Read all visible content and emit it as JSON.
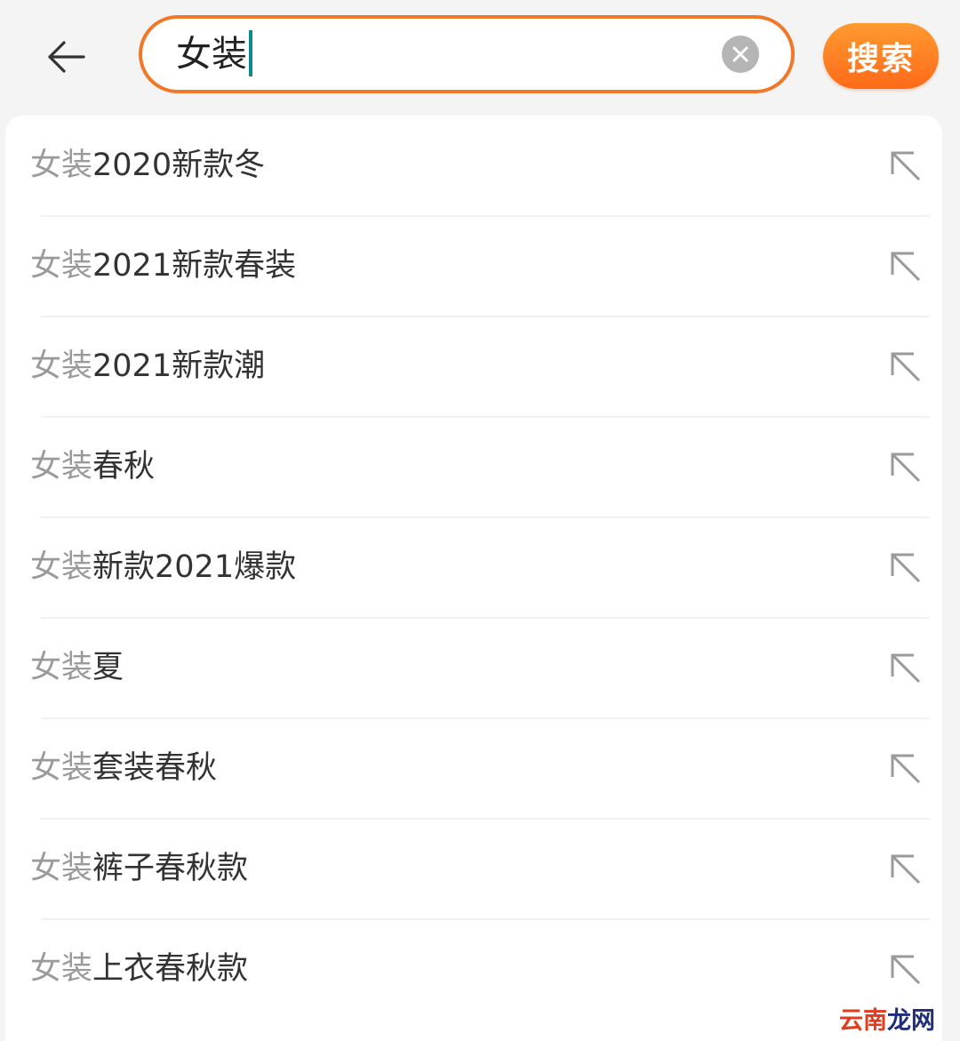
{
  "header": {
    "back_icon": "arrow-left-icon",
    "search": {
      "value": "女装",
      "clear_icon": "clear-circle-x-icon"
    },
    "search_button_label": "搜索"
  },
  "suggestions": [
    {
      "prefix": "女装",
      "suffix": "2020新款冬",
      "fill_icon": "arrow-up-left-icon"
    },
    {
      "prefix": "女装",
      "suffix": "2021新款春装",
      "fill_icon": "arrow-up-left-icon"
    },
    {
      "prefix": "女装",
      "suffix": "2021新款潮",
      "fill_icon": "arrow-up-left-icon"
    },
    {
      "prefix": "女装",
      "suffix": "春秋",
      "fill_icon": "arrow-up-left-icon"
    },
    {
      "prefix": "女装",
      "suffix": "新款2021爆款",
      "fill_icon": "arrow-up-left-icon"
    },
    {
      "prefix": "女装",
      "suffix": "夏",
      "fill_icon": "arrow-up-left-icon"
    },
    {
      "prefix": "女装",
      "suffix": "套装春秋",
      "fill_icon": "arrow-up-left-icon"
    },
    {
      "prefix": "女装",
      "suffix": "裤子春秋款",
      "fill_icon": "arrow-up-left-icon"
    },
    {
      "prefix": "女装",
      "suffix": "上衣春秋款",
      "fill_icon": "arrow-up-left-icon"
    }
  ],
  "watermark": {
    "part1": "云南",
    "part2": "龙网"
  },
  "colors": {
    "accent": "#f0782a",
    "button_gradient_top": "#ff9a30",
    "button_gradient_bottom": "#ff6a18",
    "caret": "#0e8a8a"
  }
}
